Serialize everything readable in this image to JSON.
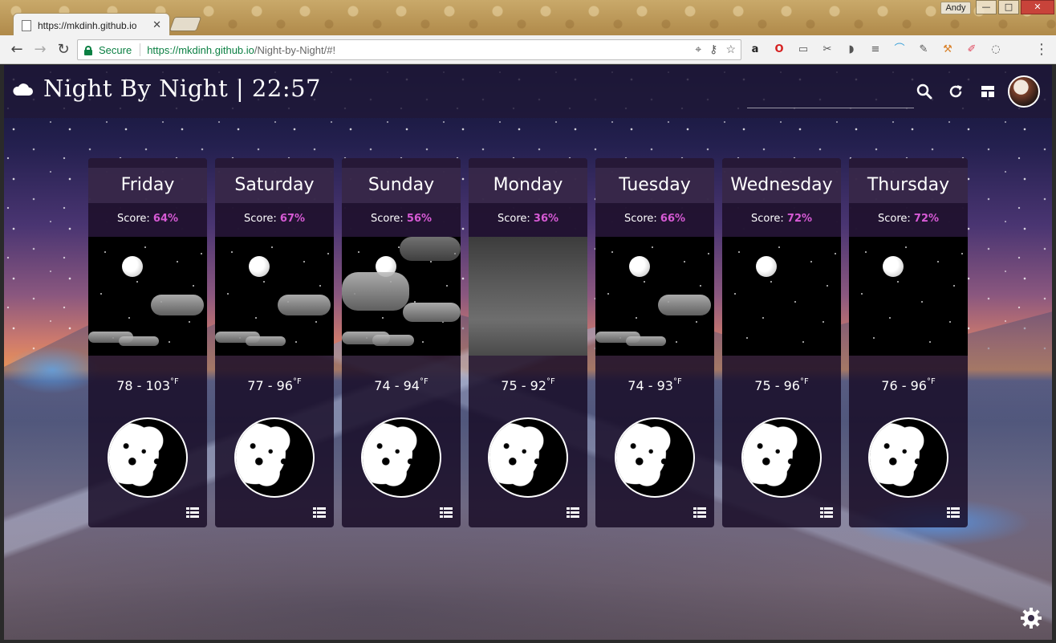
{
  "browser": {
    "tab_title": "https://mkdinh.github.io",
    "user_name": "Andy",
    "secure_label": "Secure",
    "url_host": "https://mkdinh.github.io",
    "url_path": "/Night-by-Night/#!",
    "window_buttons": {
      "minimize": "—",
      "maximize": "□",
      "close": "✕"
    }
  },
  "app": {
    "title": "Night By Night | 22:57"
  },
  "days": [
    {
      "day": "Friday",
      "score_label": "Score: ",
      "score": "64%",
      "temp": "78 - 103",
      "unit": "°F",
      "sky": "partly-cloudy"
    },
    {
      "day": "Saturday",
      "score_label": "Score: ",
      "score": "67%",
      "temp": "77 - 96",
      "unit": "°F",
      "sky": "partly-cloudy"
    },
    {
      "day": "Sunday",
      "score_label": "Score: ",
      "score": "56%",
      "temp": "74 - 94",
      "unit": "°F",
      "sky": "cloudy"
    },
    {
      "day": "Monday",
      "score_label": "Score: ",
      "score": "36%",
      "temp": "75 - 92",
      "unit": "°F",
      "sky": "overcast"
    },
    {
      "day": "Tuesday",
      "score_label": "Score: ",
      "score": "66%",
      "temp": "74 - 93",
      "unit": "°F",
      "sky": "partly-cloudy"
    },
    {
      "day": "Wednesday",
      "score_label": "Score: ",
      "score": "72%",
      "temp": "75 - 96",
      "unit": "°F",
      "sky": "clear"
    },
    {
      "day": "Thursday",
      "score_label": "Score: ",
      "score": "72%",
      "temp": "76 - 96",
      "unit": "°F",
      "sky": "clear"
    }
  ],
  "colors": {
    "score_accent": "#d75ad5",
    "header_bg": "#201838",
    "secure_green": "#0b8043"
  }
}
